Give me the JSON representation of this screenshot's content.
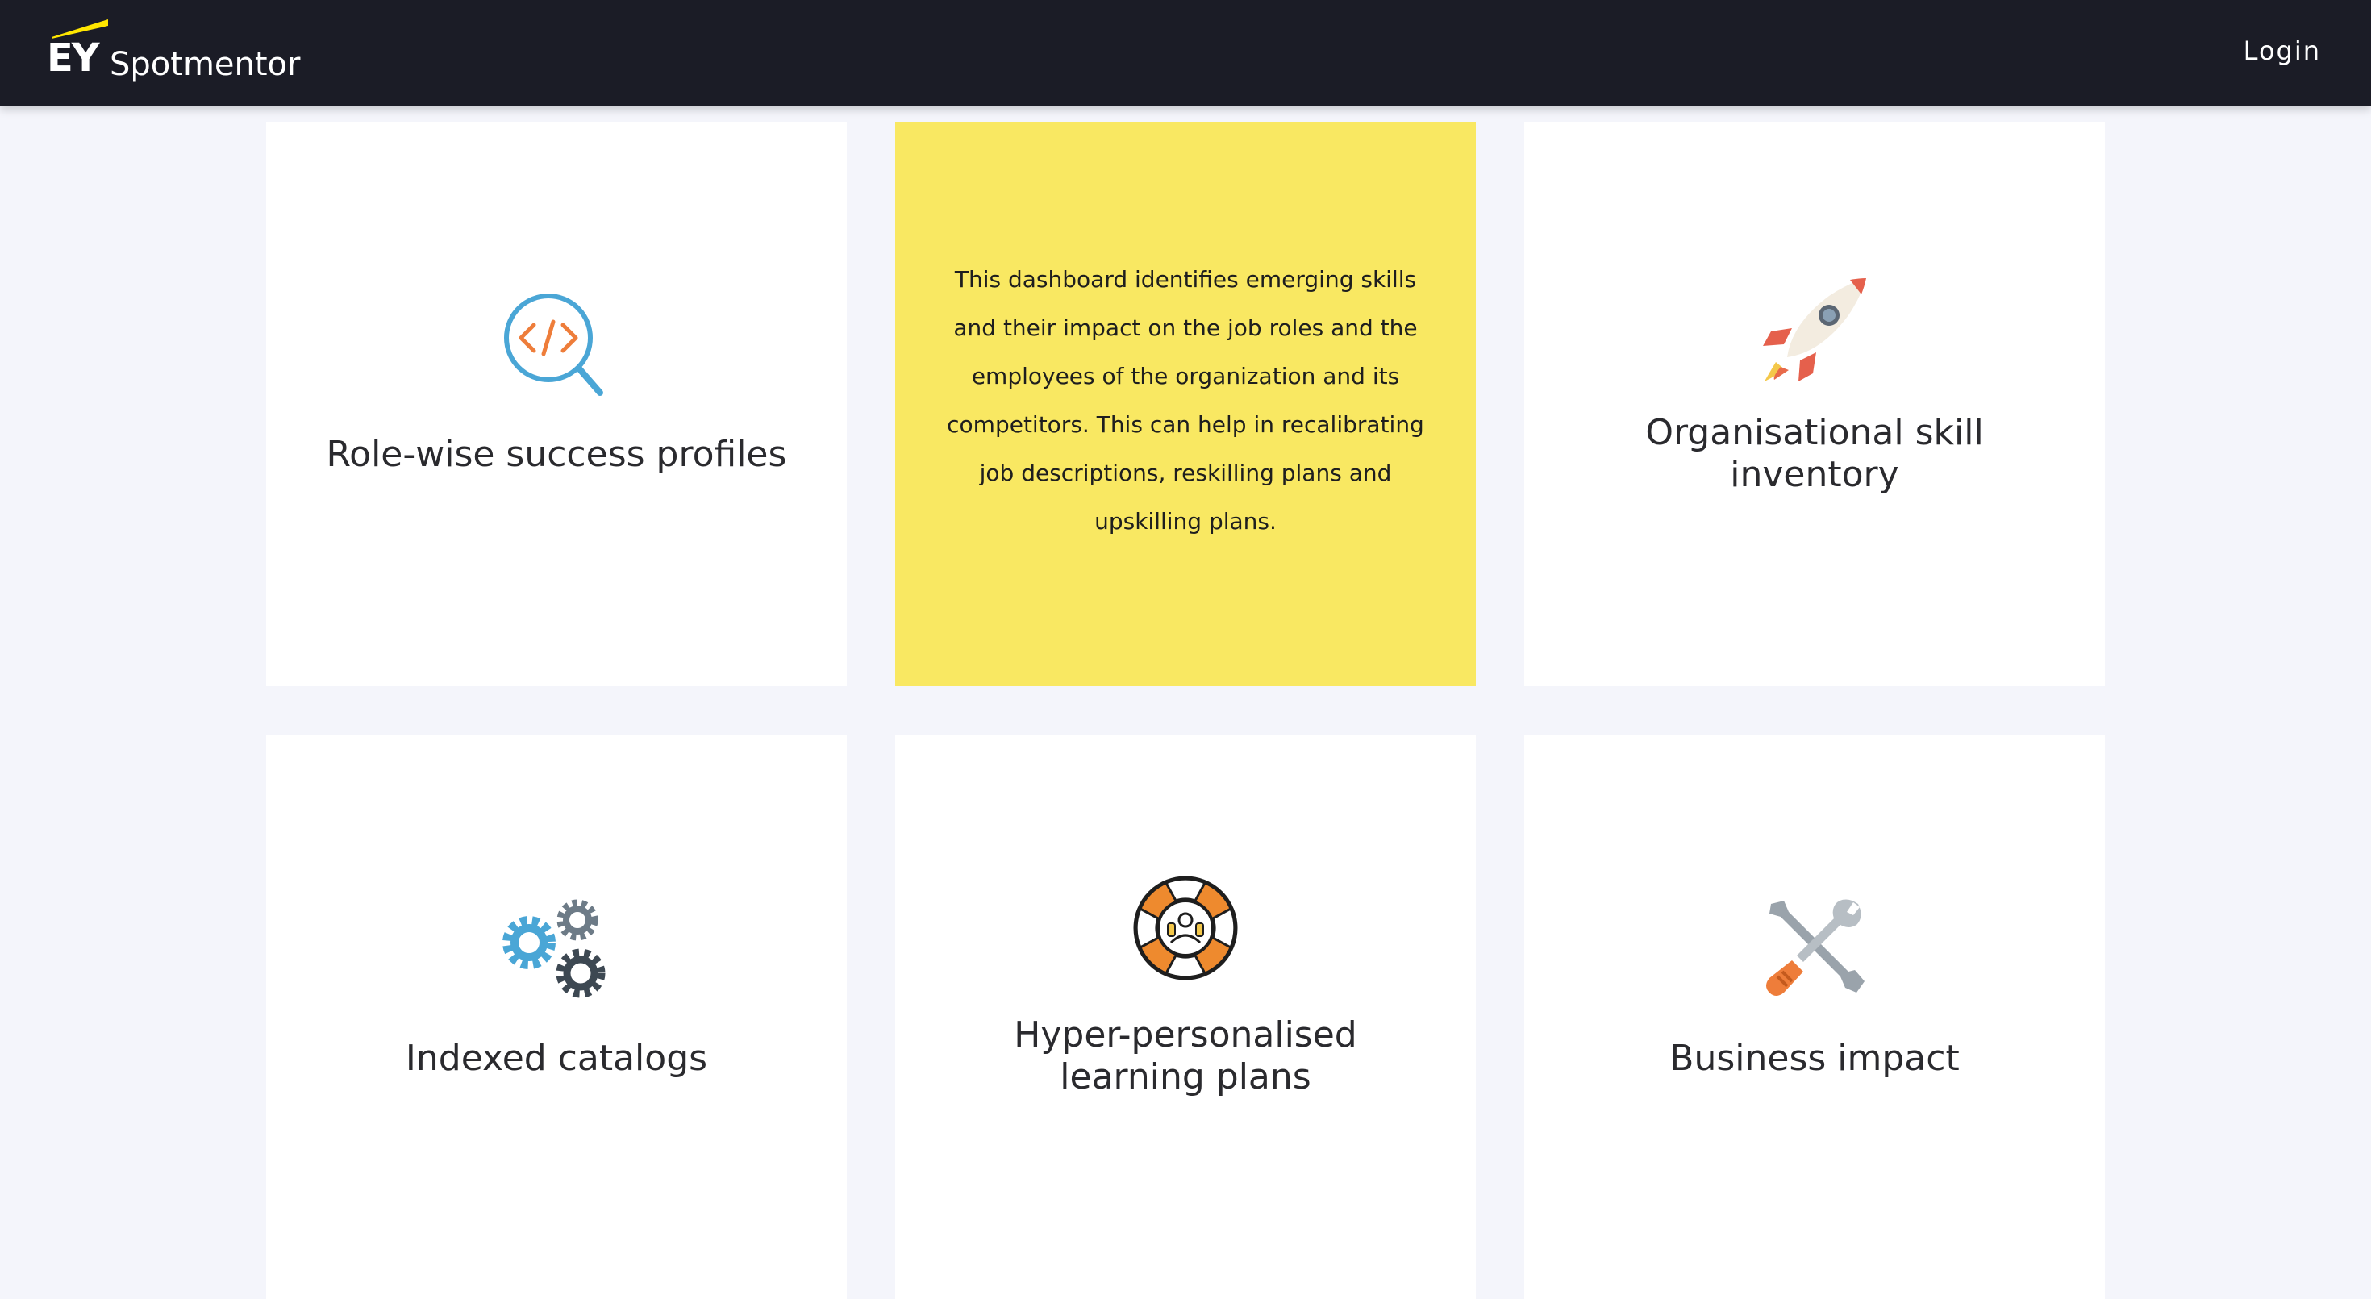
{
  "header": {
    "logo_text": "EY",
    "brand_name": "Spotmentor",
    "login_label": "Login",
    "brand_accent_color": "#ffe600",
    "background_color": "#1b1c26"
  },
  "cards": [
    {
      "title": "Role-wise success profiles",
      "icon": "code-search-icon"
    },
    {
      "description": "This dashboard identifies emerging skills and their impact on the job roles and the employees of the organization and its competitors. This can help in recalibrating job descriptions, reskilling plans and upskilling plans.",
      "highlight_color": "#f9e862"
    },
    {
      "title": "Organisational skill inventory",
      "icon": "rocket-icon"
    },
    {
      "title": "Indexed catalogs",
      "icon": "gears-icon"
    },
    {
      "title": "Hyper-personalised learning plans",
      "icon": "lifebuoy-support-icon"
    },
    {
      "title": "Business impact",
      "icon": "tools-icon"
    }
  ]
}
